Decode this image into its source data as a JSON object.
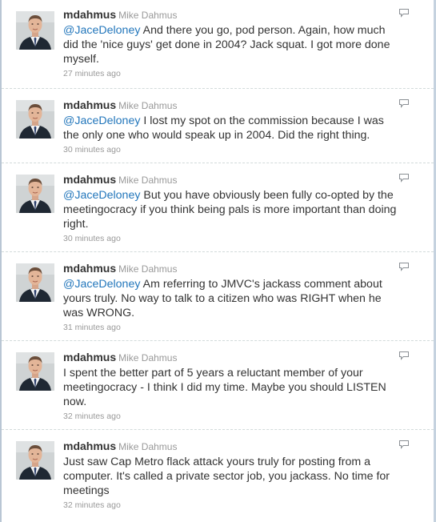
{
  "tweets": [
    {
      "screen_name": "mdahmus",
      "full_name": "Mike Dahmus",
      "mention": "@JaceDeloney",
      "text": "And there you go, pod person. Again, how much did the 'nice guys' get done in 2004? Jack squat. I got more done myself.",
      "time": "27 minutes ago"
    },
    {
      "screen_name": "mdahmus",
      "full_name": "Mike Dahmus",
      "mention": "@JaceDeloney",
      "text": "I lost my spot on the commission because I was the only one who would speak up in 2004. Did the right thing.",
      "time": "30 minutes ago"
    },
    {
      "screen_name": "mdahmus",
      "full_name": "Mike Dahmus",
      "mention": "@JaceDeloney",
      "text": "But you have obviously been fully co-opted by the meetingocracy if you think being pals is more important than doing right.",
      "time": "30 minutes ago"
    },
    {
      "screen_name": "mdahmus",
      "full_name": "Mike Dahmus",
      "mention": "@JaceDeloney",
      "text": "Am referring to JMVC's jackass comment about yours truly. No way to talk to a citizen who was RIGHT when he was WRONG.",
      "time": "31 minutes ago"
    },
    {
      "screen_name": "mdahmus",
      "full_name": "Mike Dahmus",
      "mention": "",
      "text": "I spent the better part of 5 years a reluctant member of your meetingocracy - I think I did my time. Maybe you should LISTEN now.",
      "time": "32 minutes ago"
    },
    {
      "screen_name": "mdahmus",
      "full_name": "Mike Dahmus",
      "mention": "",
      "text": "Just saw Cap Metro flack attack yours truly for posting from a computer. It's called a private sector job, you jackass. No time for meetings",
      "time": "32 minutes ago"
    }
  ],
  "icons": {
    "reply": "reply-icon",
    "avatar": "avatar"
  },
  "colors": {
    "link": "#2276bb",
    "meta": "#999999",
    "text": "#333333"
  }
}
